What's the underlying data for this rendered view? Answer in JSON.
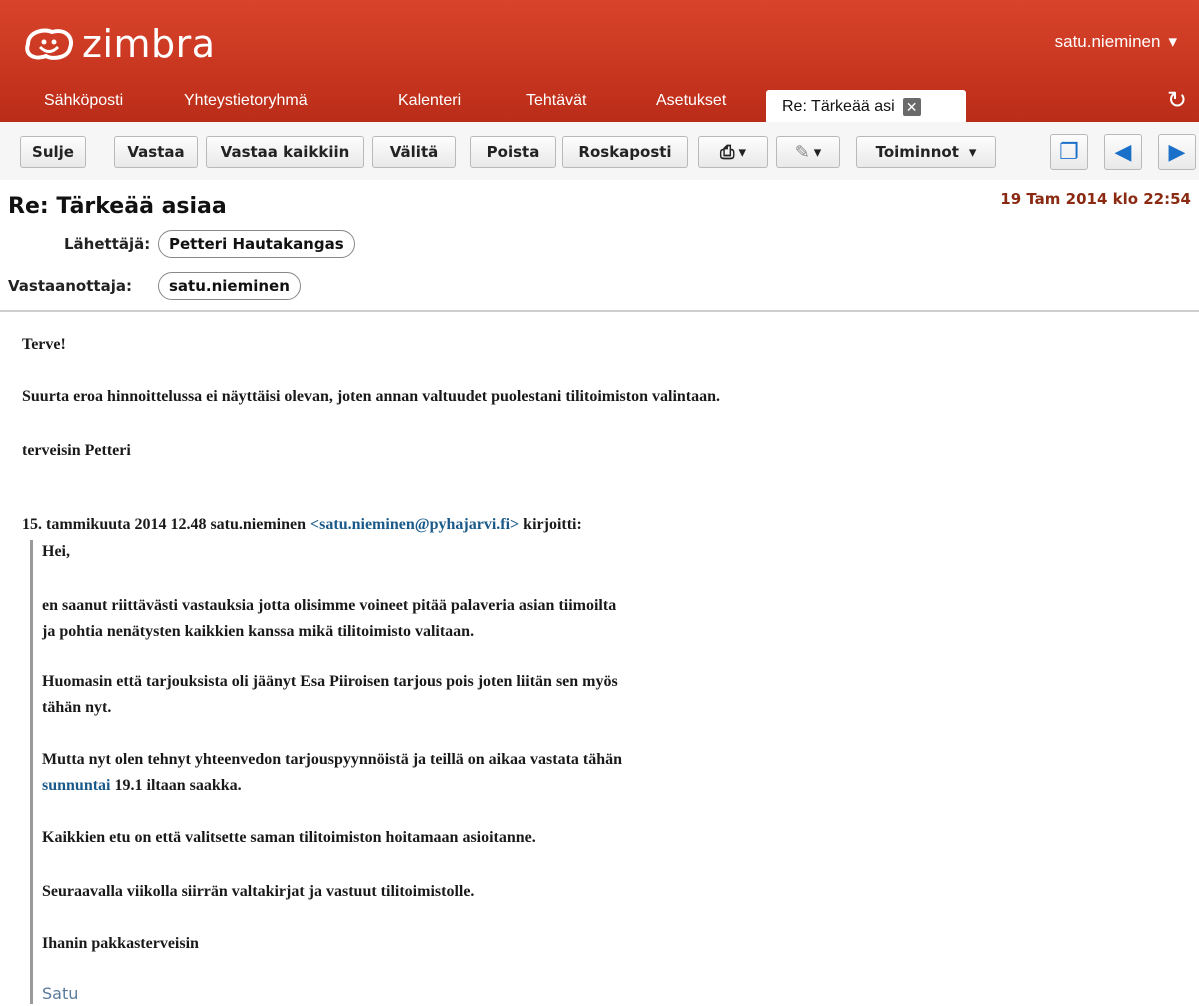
{
  "app": {
    "brand": "zimbra",
    "user": "satu.nieminen"
  },
  "tabs": [
    "Sähköposti",
    "Yhteystietoryhmä",
    "Kalenteri",
    "Tehtävät",
    "Asetukset"
  ],
  "active_tab": "Re: Tärkeää asi",
  "toolbar": {
    "close": "Sulje",
    "reply": "Vastaa",
    "reply_all": "Vastaa kaikkiin",
    "forward": "Välitä",
    "delete": "Poista",
    "spam": "Roskaposti",
    "actions": "Toiminnot"
  },
  "message": {
    "subject": "Re: Tärkeää asiaa",
    "date": "19 Tam 2014 klo 22:54",
    "from_label": "Lähettäjä:",
    "from": "Petteri Hautakangas",
    "to_label": "Vastaanottaja:",
    "to": "satu.nieminen",
    "greeting": "Terve!",
    "line1": "Suurta eroa hinnoittelussa ei näyttäisi olevan, joten annan valtuudet puolestani tilitoimiston valintaan.",
    "signoff": "terveisin Petteri",
    "quote_header_pre": "15. tammikuuta 2014 12.48 satu.nieminen ",
    "quote_header_email": "<satu.nieminen@pyhajarvi.fi>",
    "quote_header_post": " kirjoitti:",
    "quote": {
      "hei": "Hei,",
      "p1a": "en saanut riittävästi vastauksia jotta olisimme voineet pitää palaveria asian tiimoilta",
      "p1b": "ja pohtia nenätysten kaikkien kanssa mikä tilitoimisto valitaan.",
      "p2a": "Huomasin että tarjouksista oli jäänyt Esa Piiroisen tarjous pois joten liitän sen myös",
      "p2b": "tähän nyt.",
      "p3a": "Mutta nyt olen tehnyt yhteenvedon tarjouspyynnöistä ja teillä on aikaa vastata tähän",
      "p3b_link": "sunnuntai",
      "p3b_rest": " 19.1 iltaan saakka.",
      "p4": "Kaikkien etu on että valitsette saman tilitoimiston hoitamaan asioitanne.",
      "p5": "Seuraavalla viikolla siirrän valtakirjat ja vastuut tilitoimistolle.",
      "p6": "Ihanin pakkasterveisin",
      "sign": "Satu"
    }
  },
  "colors": {
    "header_red": "#c8351f",
    "date_color": "#8a2a12",
    "link_blue": "#1a5a8a"
  }
}
